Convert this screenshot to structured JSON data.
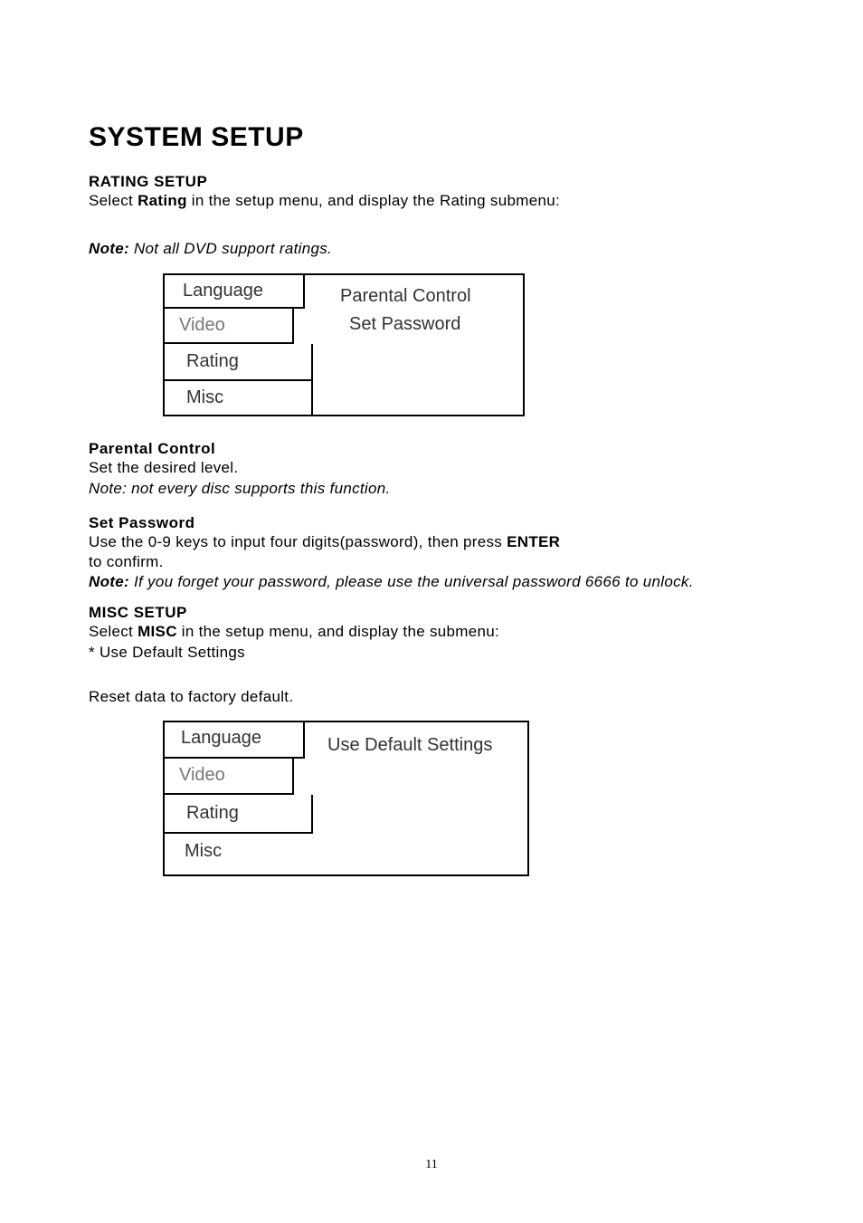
{
  "page_title": "SYSTEM SETUP",
  "rating_setup": {
    "heading": "RATING SETUP",
    "select_text_1": "Select ",
    "select_bold": "Rating",
    "select_text_2": " in the setup menu, and display the Rating submenu:"
  },
  "note1": {
    "label": "Note:",
    "text": " Not all DVD support ratings."
  },
  "menu1": {
    "tabs": {
      "language": "Language",
      "video": "Video",
      "rating": "Rating",
      "misc": "Misc"
    },
    "content": {
      "line1": "Parental Control",
      "line2": "Set Password"
    }
  },
  "parental_control": {
    "heading": "Parental Control",
    "line1": "Set the desired level.",
    "note": "Note: not every disc supports this function."
  },
  "set_password": {
    "heading": "Set Password",
    "line1_a": "Use the 0-9 keys to input four digits(password), then press ",
    "line1_bold": "ENTER",
    "line2": "to confirm.",
    "note_label": "Note:",
    "note_text": " If you forget your password, please use the universal password 6666 to unlock."
  },
  "misc_setup": {
    "heading": "MISC SETUP",
    "line1_a": "Select ",
    "line1_bold": "MISC",
    "line1_b": " in the setup menu, and display the submenu:",
    "line2": "* Use Default Settings"
  },
  "reset_text": "Reset data to factory default.",
  "menu2": {
    "tabs": {
      "language": "Language",
      "video": "Video",
      "rating": "Rating",
      "misc": "Misc"
    },
    "content": "Use Default Settings"
  },
  "page_number": "11"
}
